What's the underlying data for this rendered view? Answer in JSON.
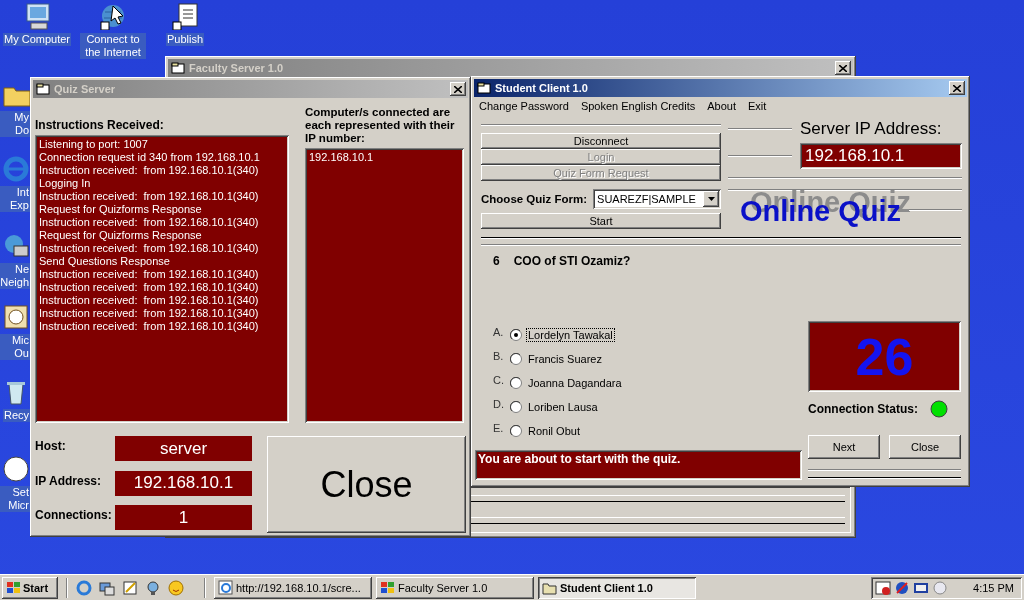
{
  "desktop": {
    "icons": [
      {
        "label": "My Computer"
      },
      {
        "label": "Connect to the Internet"
      },
      {
        "label": "Publish"
      },
      {
        "label": "My Do"
      },
      {
        "label": "Int Exp"
      },
      {
        "label": "Ne Neigh"
      },
      {
        "label": "Mic Ou"
      },
      {
        "label": "Recy"
      },
      {
        "label": "Set Micr"
      }
    ]
  },
  "faculty_server": {
    "title": "Faculty Server 1.0"
  },
  "quiz_server": {
    "title": "Quiz Server",
    "instructions_label": "Instructions Received:",
    "log": [
      "Listening to port: 1007",
      "Connection request id 340 from 192.168.10.1",
      "Instruction received:  from 192.168.10.1(340)",
      "Logging In",
      "Instruction received:  from 192.168.10.1(340)",
      "Request for Quizforms Response",
      "Instruction received:  from 192.168.10.1(340)",
      "Request for Quizforms Response",
      "Instruction received:  from 192.168.10.1(340)",
      "Send Questions Response",
      "Instruction received:  from 192.168.10.1(340)",
      "Instruction received:  from 192.168.10.1(340)",
      "Instruction received:  from 192.168.10.1(340)",
      "Instruction received:  from 192.168.10.1(340)",
      "Instruction received:  from 192.168.10.1(340)"
    ],
    "connected_label": "Computer/s connected are each represented with their IP number:",
    "connected": [
      "192.168.10.1"
    ],
    "fields": [
      {
        "label": "Host:",
        "value": "server"
      },
      {
        "label": "IP Address:",
        "value": "192.168.10.1"
      },
      {
        "label": "Connections:",
        "value": "1"
      }
    ],
    "close_button": "Close"
  },
  "student_client": {
    "title": "Student Client 1.0",
    "menu": [
      "Change Password",
      "Spoken English Credits",
      "About",
      "Exit"
    ],
    "buttons": [
      {
        "label": "Disconnect",
        "disabled": false
      },
      {
        "label": "Login",
        "disabled": true
      },
      {
        "label": "Quiz Form Request",
        "disabled": true
      }
    ],
    "choose_label": "Choose Quiz Form:",
    "quiz_form": "SUAREZF|SAMPLE",
    "start_button": "Start",
    "server_ip_label": "Server IP Address:",
    "server_ip": "192.168.10.1",
    "logo": "Online Quiz",
    "question_number": "6",
    "question": "COO of STI Ozamiz?",
    "options": [
      {
        "letter": "A.",
        "text": "Lordelyn Tawakal",
        "selected": true
      },
      {
        "letter": "B.",
        "text": "Francis Suarez",
        "selected": false
      },
      {
        "letter": "C.",
        "text": "Joanna Dagandara",
        "selected": false
      },
      {
        "letter": "D.",
        "text": "Loriben Lausa",
        "selected": false
      },
      {
        "letter": "E.",
        "text": "Ronil Obut",
        "selected": false
      }
    ],
    "message": "You are about to start with the quiz.",
    "timer": "26",
    "connection_status": {
      "label": "Connection Status:",
      "color": "#00e000"
    },
    "next_button": "Next",
    "close_button": "Close"
  },
  "taskbar": {
    "start": "Start",
    "tasks": [
      {
        "label": "http://192.168.10.1/scre...",
        "selected": false
      },
      {
        "label": "Faculty Server 1.0",
        "selected": false
      },
      {
        "label": "Student Client 1.0",
        "selected": true
      }
    ],
    "clock": "4:15 PM"
  }
}
